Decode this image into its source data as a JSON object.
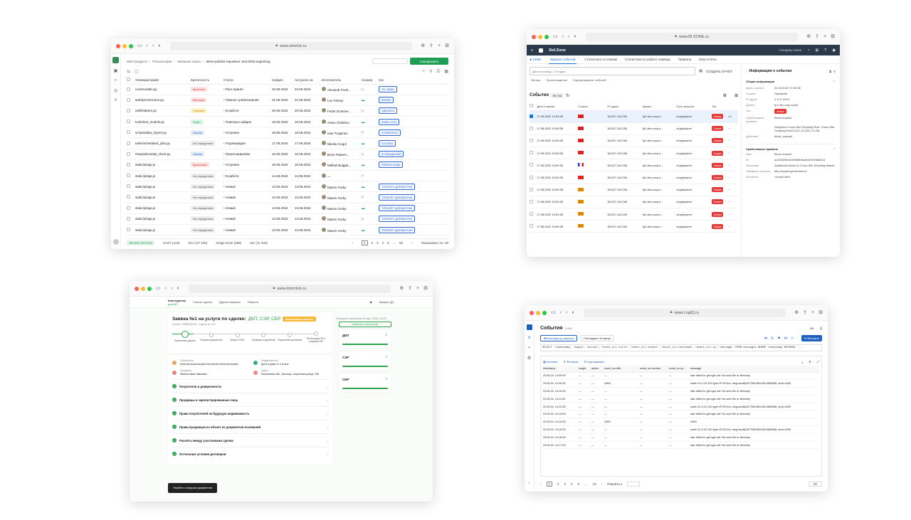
{
  "w1": {
    "url": "www.sherlok.ru",
    "crumbs": [
      "Имя продукта",
      "Репозитории",
      "Название папки",
      "demo-publick-repos/wor..test-2023-superlong"
    ],
    "scan_btn": "Сканировать",
    "headers": [
      "Уязвимый файл",
      "Критичность",
      "Статус",
      "Найден",
      "Актуален на",
      "Исполнитель",
      "Сканер",
      "Зга"
    ],
    "rows": [
      [
        "core/models.py",
        "Критично",
        "Риск принят",
        "22.06.2024",
        "22.06.2024",
        "Alexandr Push...",
        "TK-78455"
      ],
      [
        "auth/permissions.py",
        "Высокая",
        "Ложное срабатывание",
        "21.06.2024",
        "21.06.2024",
        "Lev Tolstoy",
        "ВЗЯЛИ"
      ],
      [
        "utils/helpers.py",
        "Средняя",
        "В работе",
        "20.06.2024",
        "20.06.2024",
        "Fedor Dostoev...",
        "СДЕЛАТЬ"
      ],
      [
        "tools/test_models.py",
        "Инфо",
        "Повторно найден",
        "19.06.2024",
        "19.06.2024",
        "Anton Chekhov",
        "SHER-1231"
      ],
      [
        "scripts/data_import.py",
        "Низкая",
        "Устранён",
        "18.06.2024",
        "18.06.2024",
        "Ivan Turgenev",
        "ОТМЕНЕНО"
      ],
      [
        "tasks/scheduled_jobs.py",
        "Не определена",
        "Подтверждён",
        "17.06.2024",
        "17.06.2024",
        "Nikolai Gogol",
        "ГОТОВО"
      ],
      [
        "integrations/api_client.py",
        "Низкая",
        "Проигнорирован",
        "16.06.2024",
        "16.06.2024",
        "Boris Pastern...",
        "В ОЖИДАНИИ"
      ],
      [
        "static/js/app.js",
        "Критичная",
        "Устранён",
        "15.06.2024",
        "15.06.2024",
        "Mikhail Bulgak...",
        "РЕВЬЮ КОДА"
      ],
      [
        "static/js/app.js",
        "Не определена",
        "В работе",
        "14.06.2024",
        "14.06.2024",
        "—",
        ""
      ],
      [
        "static/js/app.js",
        "Не определена",
        "Новый",
        "13.06.2024",
        "13.06.2024",
        "Maxim Gorky",
        "ТРЕБУЕТ ДОРАБОТКИ"
      ],
      [
        "static/js/app.js",
        "Не определена",
        "Новый",
        "13.06.2024",
        "13.06.2024",
        "Maxim Gorky",
        "ТРЕБУЕТ ДОРАБОТКИ"
      ],
      [
        "static/js/app.js",
        "Не определена",
        "Новый",
        "13.06.2024",
        "13.06.2024",
        "Maxim Gorky",
        "ТРЕБУЕТ ДОРАБОТКИ"
      ],
      [
        "static/js/app.js",
        "Не определена",
        "Новый",
        "13.06.2024",
        "13.06.2024",
        "Maxim Gorky",
        "ТРЕБУЕТ ДОРАБОТКИ"
      ],
      [
        "static/js/app.js",
        "Не определена",
        "Новый",
        "13.06.2024",
        "13.06.2024",
        "Maxim Gorky",
        "ТРЕБУЕТ ДОРАБОТКИ"
      ]
    ],
    "tabs": [
      "Secrets (10 211)",
      "SAST (123)",
      "SCA (37 192)",
      "Image Scan (485)",
      "IaC (11 943)"
    ],
    "pages": [
      "1",
      "2",
      "3",
      "4",
      "5",
      "…",
      "50"
    ],
    "per_page": "Показывать по: 20"
  },
  "w2": {
    "url": "www.BI.ZONE.ru",
    "brand": "Def.Zone",
    "company": "Company name",
    "nav": [
      "Журнал событий",
      "Статистика по атакам",
      "Статистика по работе сервера",
      "Правила",
      "Мои отчеты"
    ],
    "search_ph": "Дата в период = Сегодня",
    "report_btn": "СОЗДАТЬ ОТЧЕТ",
    "filters": [
      "Фильтр",
      "Происхождение",
      "Подтверждение событий"
    ],
    "events_label": "События",
    "events_count": "99 744",
    "headers": [
      "Дата и время",
      "Страна",
      "IP адрес",
      "Домен",
      "Путь запроса",
      "Тип"
    ],
    "rows": [
      [
        "17.08.2022 13:09:35",
        "38.247.143.254",
        "fp1.dev-corp.e...",
        "/crypt/pwnrr/",
        "Атака"
      ],
      [
        "17.08.2022 13:09:35",
        "38.247.143.254",
        "fp1.dev-corp.e...",
        "/crypt/pwnrr/",
        "Атака"
      ],
      [
        "17.08.2022 13:09:35",
        "38.247.143.254",
        "fp1.dev-corp.e...",
        "/crypt/pwnrr/",
        "Атака"
      ],
      [
        "17.08.2022 13:09:35",
        "38.247.143.254",
        "fp1.dev-corp.e...",
        "/crypt/pwnrr/",
        "Атака"
      ],
      [
        "17.08.2022 13:09:35",
        "38.247.143.254",
        "fp1.dev-corp.e...",
        "/crypt/pwnrr/",
        "Атака"
      ],
      [
        "17.08.2022 13:09:35",
        "38.247.143.254",
        "fp1.dev-corp.e...",
        "/crypt/pwnrr/",
        "Атака"
      ],
      [
        "17.08.2022 13:09:35",
        "38.247.143.254",
        "fp1.dev-corp.e...",
        "/crypt/pwnrr/",
        "Атака"
      ],
      [
        "17.08.2022 13:09:35",
        "38.247.143.254",
        "fp1.dev-corp.e...",
        "/crypt/pwnrr/",
        "Атака"
      ],
      [
        "17.08.2022 13:09:35",
        "38.247.143.254",
        "fp1.dev-corp.e...",
        "/crypt/pwnrr/",
        "Атака"
      ],
      [
        "17.08.2022 13:09:35",
        "38.247.143.254",
        "fp1.dev-corp.e...",
        "/crypt/pwnrr/",
        "Атака"
      ]
    ],
    "panel_title": "Информация о событии",
    "general": "Общая информация",
    "kv": [
      [
        "Дата и время",
        "01.03.2022 17:03:36"
      ],
      [
        "Страна",
        "Германия"
      ],
      [
        "IP адрес",
        "2.174.134.9"
      ],
      [
        "Домен",
        "fp1.dev-corp.email"
      ],
      [
        "Тип",
        "Атака"
      ],
      [
        "Сработавшие правила",
        "Block request"
      ],
      [
        "",
        "Simpleton Cross-Site Scripting Rule. Cross-Site Scripting test111 [01.12.2021 11:03]"
      ],
      [
        "Действие",
        "block_request"
      ]
    ],
    "rules_title": "Сработавшие правила",
    "rules": [
      [
        "Имя",
        "Block request"
      ],
      [
        "ID",
        "a14b0389c4e3b9b8b6a4bfd7e9da8d2c1"
      ],
      [
        "Описание",
        "Additional check for Cross Site Scripting attacks"
      ],
      [
        "Параметр запроса",
        "http.request.get.foobar.url"
      ],
      [
        "Значение",
        "<script>alert"
      ]
    ]
  },
  "w3": {
    "url": "www.domclick.ru",
    "brand": "Конструктор",
    "brand_sub": "для ДС",
    "nav": [
      "Список сделок",
      "Другие сервисы",
      "Новости"
    ],
    "user": "Аккаунт ДС",
    "title": "Заявка №1 на услуги по сделке:",
    "title_services": "ДКП, СЭР, СБР",
    "badge": "Заполнение данных",
    "sub": "Проект 27868005205 · Сделка № 123",
    "updated": "Последнее изменение 03 мар. 2024 в 16:37",
    "steps": [
      "Заполнение данных",
      "Загрузка документов",
      "Выпуск УКЭП",
      "Проверка и доработки",
      "Подписание договоров",
      "Регистрация ЭР и отправка СБР"
    ],
    "seller_role": "Покупатель",
    "seller": "Константинопольский Константин Константинович",
    "buyer_role": "Продавец",
    "buyer": "Иванов Иван Иванович",
    "realty_role": "Недвижимость",
    "realty": "Доля в доме от 4,5 кв.м",
    "addr_role": "Адрес",
    "addr": "Московская обл., Мытищи, Сиреневая улица, 236",
    "sections": [
      "Покупатели и доверенности",
      "Продавцы и зарегистрированные лица",
      "Права покупателей на будущую недвижимость",
      "Права продавцов на объект из документов-оснований",
      "Расчёты между участниками сделки",
      "Остальные условия договоров"
    ],
    "side_btn": "Изменить список услуг",
    "services": [
      "ДКП",
      "СЭР",
      "СБР"
    ],
    "go_btn": "Перейти к загрузке документов"
  },
  "w4": {
    "url": "www.LogIQ.ru",
    "title": "События",
    "count": "5 988",
    "btn_constructor": "Конструктор запроса",
    "range": "Последние 15 минут",
    "refresh": "Обновить",
    "query": "SELECT 'timestamp','msgid','action','event_src.title','event_src.vendor','event_src.hostname','event_src.ip','message' FROM messages WHERE timestamp BETWEEN '...",
    "tools": [
      "Колонки",
      "Фильтры",
      "Группировка"
    ],
    "cols": [
      "timestamp",
      "msgid",
      "action",
      "event_src.title",
      "event_src.vendor",
      "event_src.ip",
      "message"
    ],
    "rows": [
      [
        "23.06.24, 14:09:00",
        "—",
        "—",
        "—",
        "—",
        "—",
        "sda: failed to get sgio uid: No such file or directory"
      ],
      [
        "23.06.24, 14:10:00",
        "—",
        "—",
        "UNIX",
        "—",
        "—",
        "node=11.0.10.102 type=SYSCALL msg=audit(1677581564.642:886265): arch=c000"
      ],
      [
        "23.06.24, 14:10:00",
        "—",
        "—",
        "—",
        "—",
        "—",
        "sda: failed to get sgio uid: No such file or directory"
      ],
      [
        "23.06.24, 14:11:00",
        "—",
        "—",
        "—",
        "—",
        "—",
        "sda: failed to get sgio uid: No such file or directory"
      ],
      [
        "23.06.24, 14:12:00",
        "—",
        "—",
        "—",
        "—",
        "—",
        "node=11.0.10.102 type=SYSCALL msg=audit(1677581564.642:886265): arch=c000"
      ],
      [
        "23.06.24, 14:13:00",
        "—",
        "—",
        "—",
        "—",
        "—",
        "sda: failed to get sgio uid: No such file or directory"
      ],
      [
        "23.06.24, 14:14:00",
        "—",
        "—",
        "UNIX",
        "—",
        "—",
        "UNIX"
      ],
      [
        "23.06.24, 14:15:00",
        "—",
        "—",
        "—",
        "—",
        "—",
        "node=11.0.10.102 type=SYSCALL msg=audit(1677581564.642:886265): arch=c000"
      ],
      [
        "23.06.24, 14:16:00",
        "—",
        "—",
        "—",
        "—",
        "—",
        "sda: failed to get sgio uid: No such file or directory"
      ],
      [
        "23.06.24, 14:17:00",
        "—",
        "—",
        "—",
        "—",
        "—",
        "sda: failed to get sgio uid: No such file or directory"
      ]
    ],
    "pages": [
      "1",
      "2",
      "3",
      "4",
      "5",
      "…",
      "10"
    ],
    "goto": "Перейти к",
    "per_page": "20"
  }
}
